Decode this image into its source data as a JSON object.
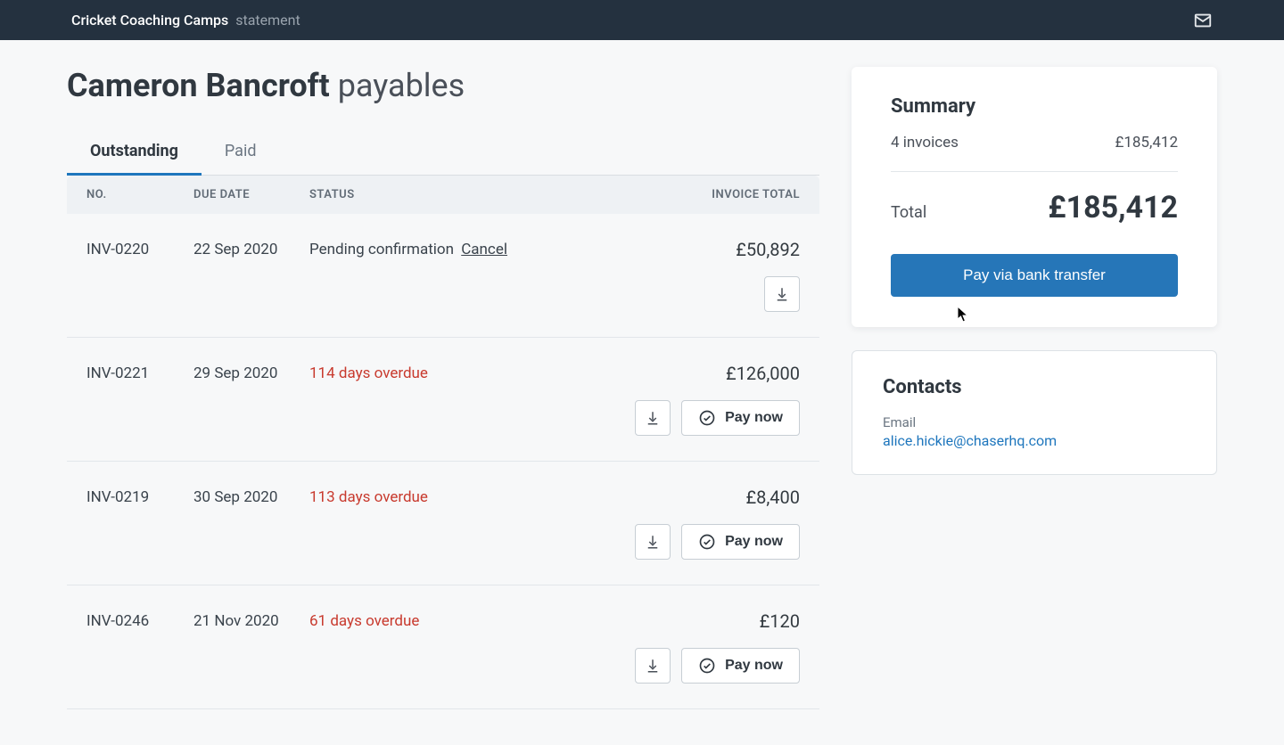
{
  "header": {
    "brand": "Cricket Coaching Camps",
    "suffix": "statement"
  },
  "page_title": {
    "strong": "Cameron Bancroft",
    "rest": "payables"
  },
  "tabs": [
    {
      "label": "Outstanding",
      "active": true
    },
    {
      "label": "Paid",
      "active": false
    }
  ],
  "columns": {
    "no": "NO.",
    "due": "DUE DATE",
    "status": "STATUS",
    "total": "INVOICE TOTAL"
  },
  "actions": {
    "pay_now": "Pay now",
    "cancel": "Cancel"
  },
  "invoices": [
    {
      "no": "INV-0220",
      "due": "22 Sep 2020",
      "status": "Pending confirmation",
      "status_kind": "pending",
      "total": "£50,892",
      "show_pay": false,
      "show_cancel": true
    },
    {
      "no": "INV-0221",
      "due": "29 Sep 2020",
      "status": "114 days overdue",
      "status_kind": "overdue",
      "total": "£126,000",
      "show_pay": true,
      "show_cancel": false
    },
    {
      "no": "INV-0219",
      "due": "30 Sep 2020",
      "status": "113 days overdue",
      "status_kind": "overdue",
      "total": "£8,400",
      "show_pay": true,
      "show_cancel": false
    },
    {
      "no": "INV-0246",
      "due": "21 Nov 2020",
      "status": "61 days overdue",
      "status_kind": "overdue",
      "total": "£120",
      "show_pay": true,
      "show_cancel": false
    }
  ],
  "summary": {
    "title": "Summary",
    "count_text": "4 invoices",
    "subtotal": "£185,412",
    "total_label": "Total",
    "total_amount": "£185,412",
    "pay_button": "Pay via bank transfer"
  },
  "contacts": {
    "title": "Contacts",
    "email_label": "Email",
    "email": "alice.hickie@chaserhq.com"
  }
}
